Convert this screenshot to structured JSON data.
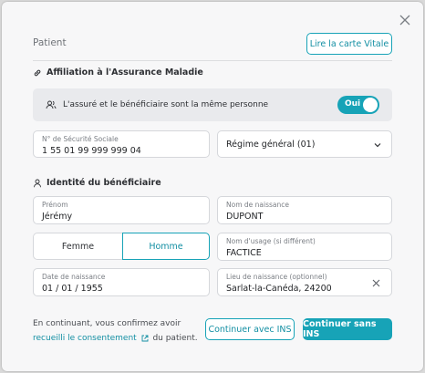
{
  "header": {
    "title": "Patient",
    "vitale_button": "Lire la carte Vitale"
  },
  "affiliation": {
    "title": "Affiliation à l'Assurance Maladie",
    "same_person_text": "L'assuré et le bénéficiaire sont la même personne",
    "toggle_label": "Oui",
    "toggle_on": true,
    "ss_label": "N° de Sécurité Sociale",
    "ss_value": "1 55 01 99 999 999 04",
    "regime_value": "Régime général (01)"
  },
  "identity": {
    "title": "Identité du bénéficiaire",
    "prenom_label": "Prénom",
    "prenom_value": "Jérémy",
    "nom_naissance_label": "Nom de naissance",
    "nom_naissance_value": "DUPONT",
    "sexe_options": [
      "Femme",
      "Homme"
    ],
    "sexe_selected": "Homme",
    "nom_usage_label": "Nom d'usage (si différent)",
    "nom_usage_value": "FACTICE",
    "date_label": "Date de naissance",
    "date_value": "01 / 01 / 1955",
    "lieu_label": "Lieu de naissance (optionnel)",
    "lieu_value": "Sarlat-la-Canéda, 24200"
  },
  "footer": {
    "text_before": "En continuant, vous confirmez avoir",
    "consent_link": "recueilli le consentement",
    "text_after": "du patient.",
    "continue_ins": "Continuer avec INS",
    "continue_no_ins": "Continuer sans INS"
  },
  "colors": {
    "accent": "#17a3b7",
    "background": "#f7f7f8"
  },
  "icons": [
    "close-icon",
    "link-icon",
    "users-icon",
    "chevron-down-icon",
    "user-icon",
    "clear-icon",
    "external-link-icon"
  ]
}
